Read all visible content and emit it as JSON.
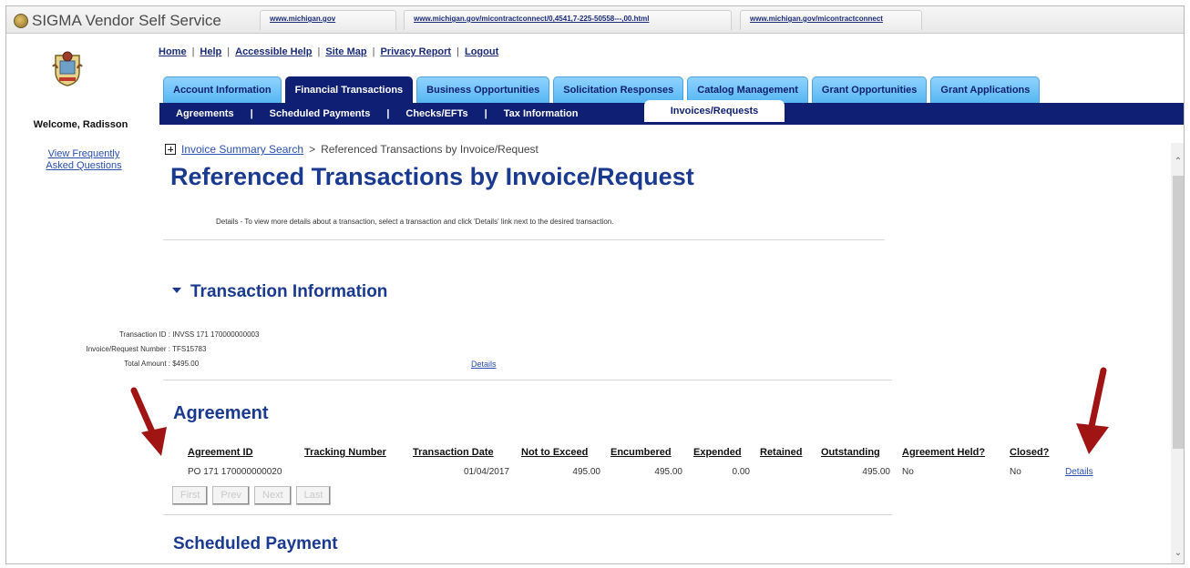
{
  "window": {
    "app_title": "SIGMA Vendor Self Service",
    "url_tabs": [
      "www.michigan.gov",
      "www.michigan.gov/micontractconnect/0,4541,7-225-50558---,00.html",
      "www.michigan.gov/micontractconnect"
    ]
  },
  "sidebar": {
    "welcome": "Welcome, Radisson",
    "faq_line1": "View Frequently",
    "faq_line2": "Asked Questions"
  },
  "top_links": [
    "Home",
    "Help",
    "Accessible Help",
    "Site Map",
    "Privacy Report",
    "Logout"
  ],
  "tabs": [
    "Account Information",
    "Financial Transactions",
    "Business Opportunities",
    "Solicitation Responses",
    "Catalog Management",
    "Grant Opportunities",
    "Grant Applications"
  ],
  "active_tab": "Financial Transactions",
  "sub_nav": [
    "Agreements",
    "Scheduled Payments",
    "Checks/EFTs",
    "Tax Information"
  ],
  "sub_nav_active": "Invoices/Requests",
  "breadcrumb": {
    "link": "Invoice Summary Search",
    "separator": ">",
    "current": "Referenced Transactions by Invoice/Request"
  },
  "page_title": "Referenced Transactions by Invoice/Request",
  "instructions": "Details - To view more details about a transaction, select a transaction and click 'Details' link next to the desired transaction.",
  "transaction": {
    "heading": "Transaction Information",
    "id_label": "Transaction ID :",
    "id_value": "INVSS 171 170000000003",
    "invoice_label": "Invoice/Request Number :",
    "invoice_value": "TFS15783",
    "amount_label": "Total Amount :",
    "amount_value": "$495.00",
    "details_link": "Details"
  },
  "agreement": {
    "heading": "Agreement",
    "columns": [
      "Agreement ID",
      "Tracking Number",
      "Transaction Date",
      "Not to Exceed",
      "Encumbered",
      "Expended",
      "Retained",
      "Outstanding",
      "Agreement Held?",
      "Closed?"
    ],
    "row": {
      "agreement_id": "PO 171 170000000020",
      "tracking_number": "",
      "transaction_date": "01/04/2017",
      "not_to_exceed": "495.00",
      "encumbered": "495.00",
      "expended": "0.00",
      "retained": "",
      "outstanding": "495.00",
      "held": "No",
      "closed": "No",
      "details": "Details"
    },
    "pager": [
      "First",
      "Prev",
      "Next",
      "Last"
    ]
  },
  "scheduled_payment": {
    "heading": "Scheduled Payment"
  },
  "colors": {
    "navy": "#0f1f73",
    "tab_blue": "#56b6f2",
    "title_blue": "#1a3a8f",
    "arrow_red": "#a01414"
  }
}
